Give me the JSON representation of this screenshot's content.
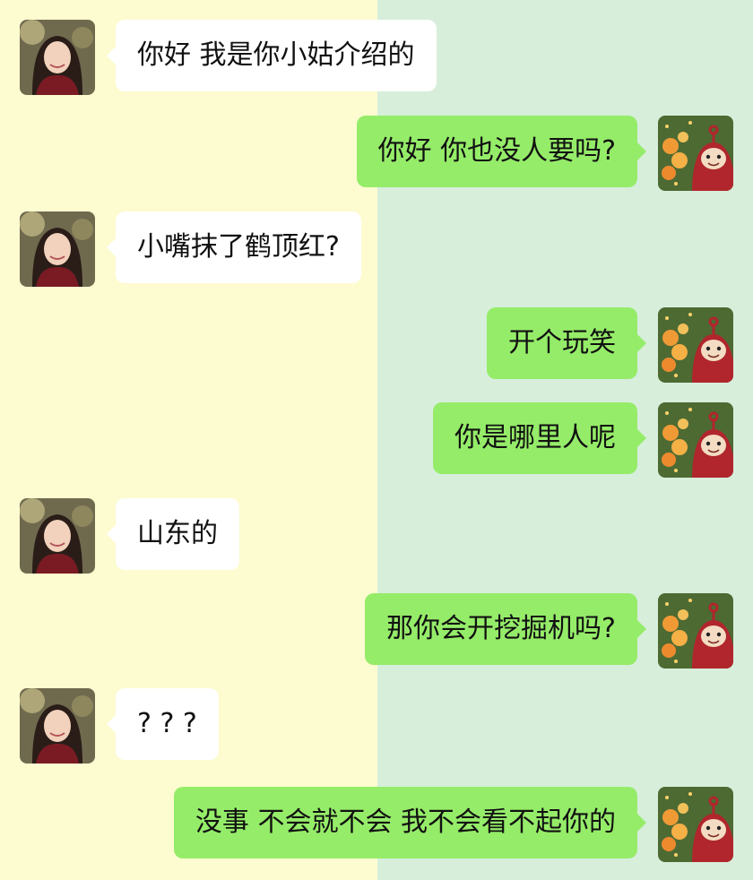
{
  "chat": {
    "messages": [
      {
        "side": "in",
        "text": "你好 我是你小姑介绍的"
      },
      {
        "side": "out",
        "text": "你好 你也没人要吗?"
      },
      {
        "side": "in",
        "text": "小嘴抹了鹤顶红?"
      },
      {
        "side": "out",
        "text": "开个玩笑"
      },
      {
        "side": "out",
        "text": "你是哪里人呢"
      },
      {
        "side": "in",
        "text": "山东的"
      },
      {
        "side": "out",
        "text": "那你会开挖掘机吗?"
      },
      {
        "side": "in",
        "text": "? ? ?"
      },
      {
        "side": "out",
        "text": "没事 不会就不会 我不会看不起你的"
      }
    ]
  },
  "colors": {
    "left_background": "#fdfbd0",
    "right_background": "#d7eedb",
    "incoming_bubble": "#ffffff",
    "outgoing_bubble": "#95ec69"
  },
  "avatars": {
    "contact": "girl-photo-avatar",
    "self": "red-teletubby-avatar"
  }
}
